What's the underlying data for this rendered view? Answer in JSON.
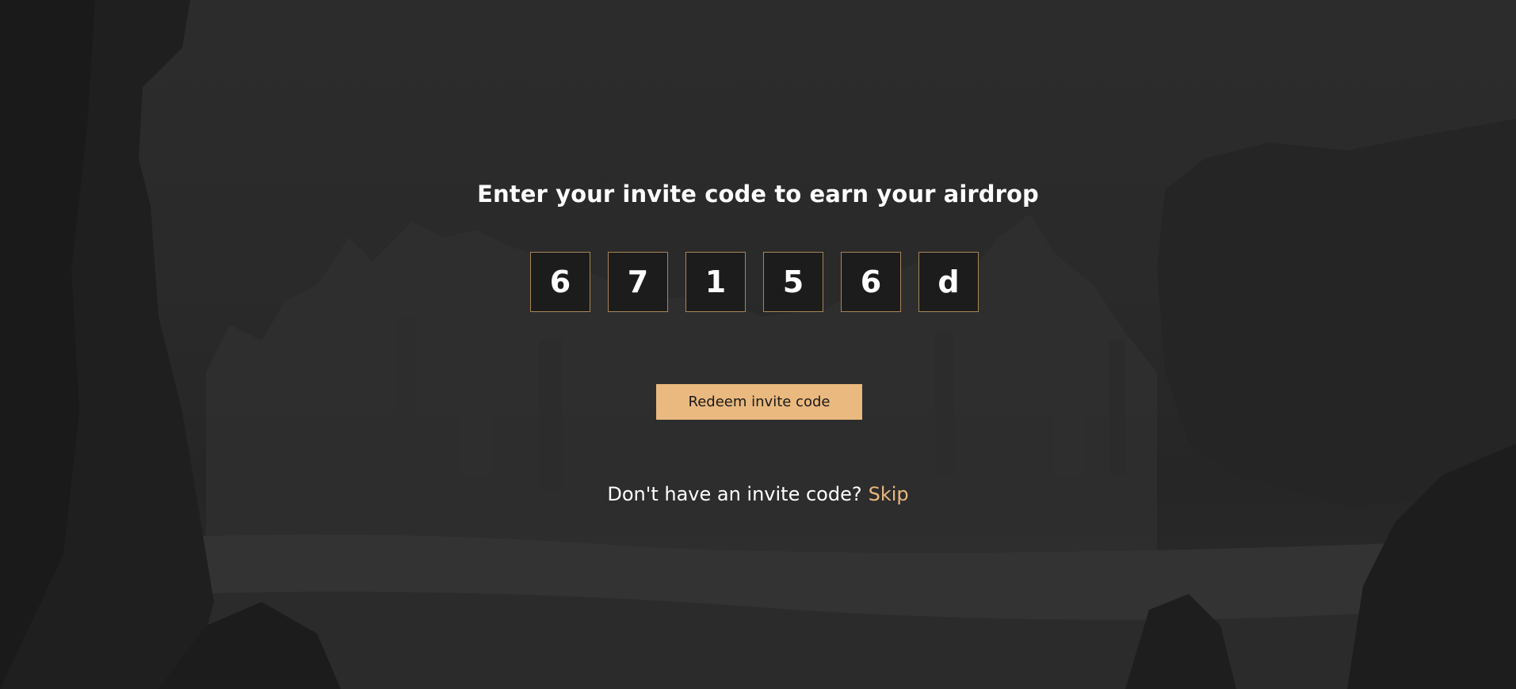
{
  "colors": {
    "accent": "#eab97f",
    "box_border": "#a88558",
    "background": "#2a2a2a"
  },
  "title": "Enter your invite code to earn your airdrop",
  "code": {
    "digits": [
      "6",
      "7",
      "1",
      "5",
      "6",
      "d"
    ]
  },
  "redeem_button": {
    "label": "Redeem invite code"
  },
  "no_code": {
    "prompt": "Don't have an invite code?",
    "skip_label": "Skip"
  }
}
